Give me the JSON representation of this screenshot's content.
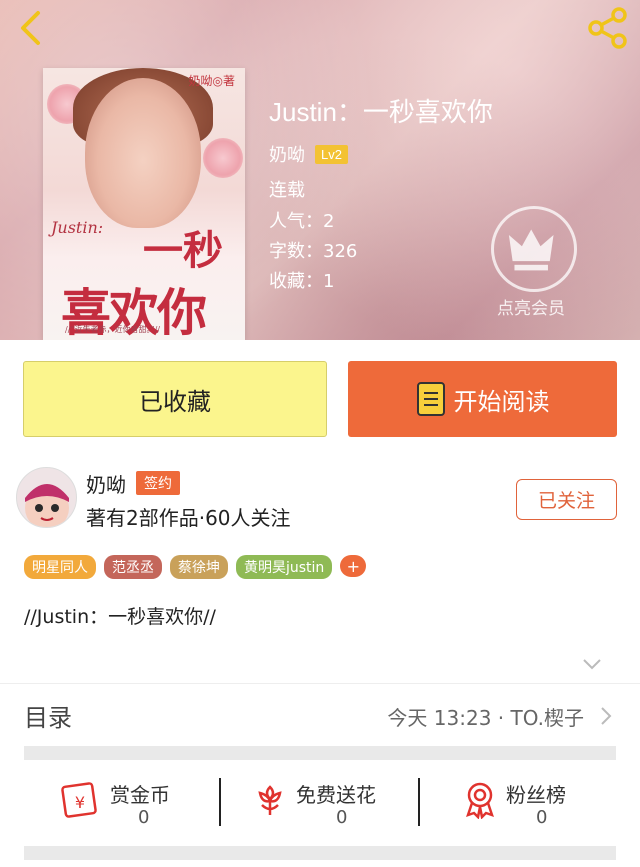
{
  "header": {
    "back_icon": "chevron-left-icon",
    "share_icon": "share-icon",
    "book_title": "Justin：一秒喜欢你",
    "author": "奶呦",
    "level": "Lv2",
    "status": "连载",
    "popularity": "人气：2",
    "word_count": "字数：326",
    "favorites": "收藏：1",
    "vip_label": "点亮会员"
  },
  "cover": {
    "author_mark": "奶呦◎著",
    "title_script": "Justin:",
    "title_line1": "一秒",
    "title_line2": "喜欢你",
    "tagline": "//“近朱者赤，近你者甜。”//"
  },
  "actions": {
    "favorite_label": "已收藏",
    "read_label": "开始阅读"
  },
  "author_card": {
    "name": "奶呦",
    "badge": "签约",
    "stats": "著有2部作品·60人关注",
    "follow_label": "已关注"
  },
  "tags": [
    {
      "label": "明星同人",
      "color": "#f2a93b"
    },
    {
      "label": "范丞丞",
      "color": "#c4665a"
    },
    {
      "label": "蔡徐坤",
      "color": "#c9a15a"
    },
    {
      "label": "黄明昊justin",
      "color": "#8fba55"
    }
  ],
  "tag_more": "+",
  "intro": "//Justin：一秒喜欢你//",
  "toc": {
    "label": "目录",
    "latest": "今天 13:23 · TO.楔子"
  },
  "bottom": {
    "reward": {
      "label": "赏金币",
      "count": "0",
      "icon": "coin-envelope-icon"
    },
    "flower": {
      "label": "免费送花",
      "count": "0",
      "icon": "flower-icon"
    },
    "fans": {
      "label": "粉丝榜",
      "count": "0",
      "icon": "medal-icon"
    }
  },
  "colors": {
    "accent": "#ee6a3a",
    "favorite_bg": "#fbf58d",
    "level_badge": "#f3c233"
  }
}
